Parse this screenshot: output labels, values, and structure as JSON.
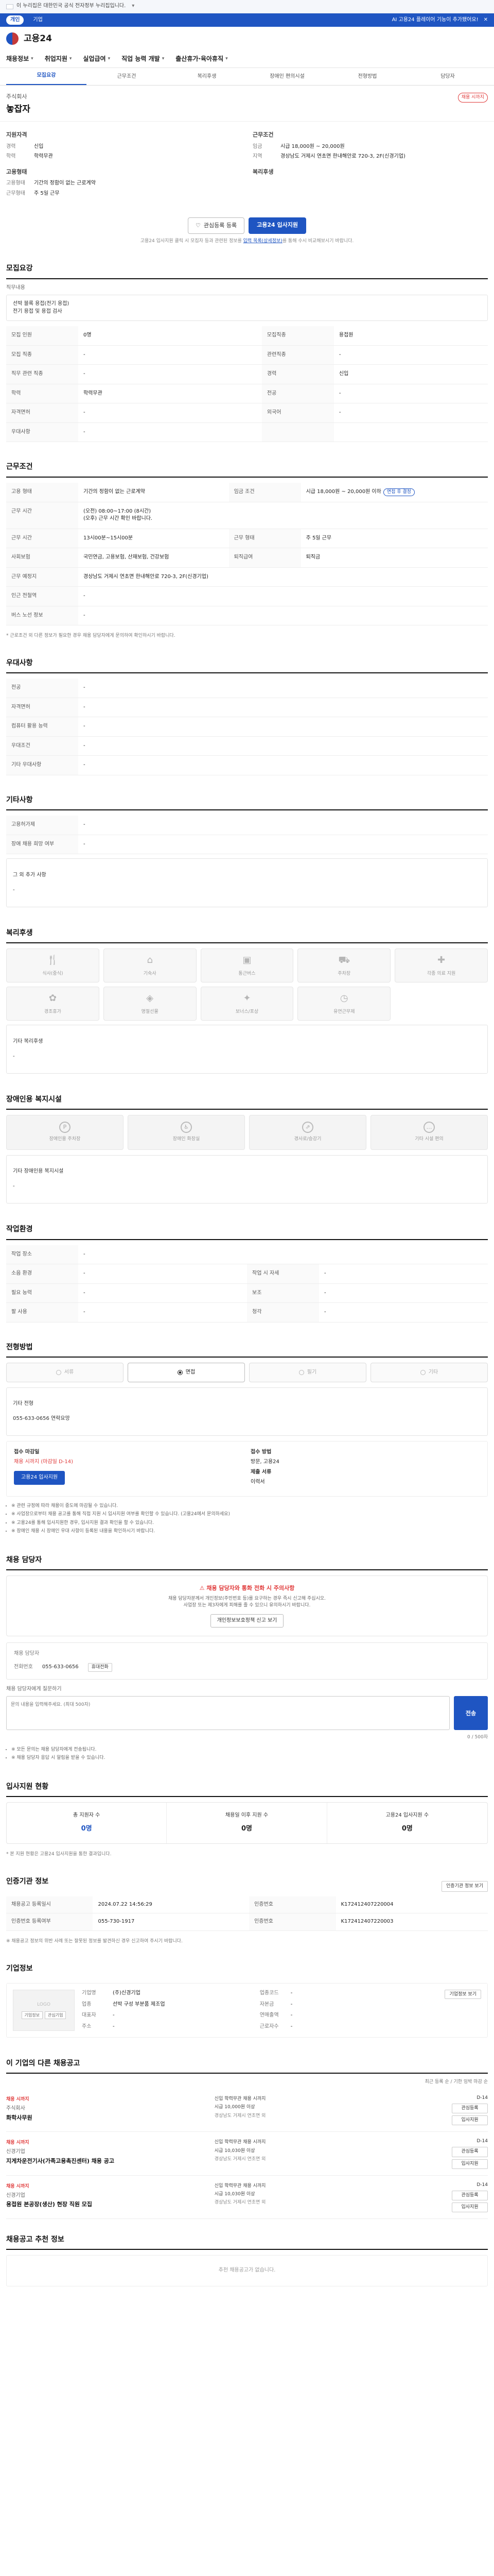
{
  "gov_notice": {
    "text": "이 누리집은 대한민국 공식 전자정부 누리집입니다."
  },
  "util_bar": {
    "segments": [
      "개인",
      "기업"
    ],
    "right_notice": "AI 고용24 플레이어 기능이 추가됐어요!"
  },
  "header": {
    "logo_text": "고용24"
  },
  "gnb": {
    "items": [
      "채용정보",
      "취업지원",
      "실업급여",
      "직업 능력 개발",
      "출산휴가·육아휴직"
    ]
  },
  "subtabs": [
    "모집요강",
    "근무조건",
    "복리후생",
    "장애인 편의시설",
    "전형방법",
    "담당자"
  ],
  "company": {
    "name": "주식회사",
    "title": "놓잡자",
    "badge": "채용 시까지"
  },
  "summary": {
    "left_title": "지원자격",
    "left_rows": [
      {
        "k": "경력",
        "v": "신입"
      },
      {
        "k": "학력",
        "v": "학력무관"
      }
    ],
    "left_title2": "고용형태",
    "left_rows2": [
      {
        "k": "고용형태",
        "v": "기간의 정함이 없는 근로계약"
      },
      {
        "k": "근무형태",
        "v": "주 5일 근무"
      }
    ],
    "right_title": "근무조건",
    "right_rows": [
      {
        "k": "임금",
        "v": "시급 18,000원 ~ 20,000원"
      },
      {
        "k": "지역",
        "v": "경상남도 거제시 연초면 한내해안로 720-3, 2F(신경기업)"
      }
    ],
    "right_title2": "복리후생",
    "right_rows2": []
  },
  "cta": {
    "interest": "관심등록 등록",
    "apply": "고용24 입사지원",
    "note_prefix": "고용24 입사지원 클릭 시 모집자 등과 관련된 정보를 ",
    "note_link": "입력 목록(상세정보)",
    "note_suffix": "를 통해 수시 비교해보시기 바랍니다."
  },
  "recruit": {
    "title": "모집요강",
    "duty_label": "직무내용",
    "duty_text": "선박 블록 용접(전기 용접)\n전기 용접 및 용접 검사",
    "rows": [
      [
        {
          "k": "모집 인원",
          "v": "0명"
        },
        {
          "k": "모집직종",
          "v": "용접원"
        }
      ],
      [
        {
          "k": "모집 직종",
          "v": "-"
        },
        {
          "k": "관련직종",
          "v": "-"
        }
      ],
      [
        {
          "k": "직무 관련 직종",
          "v": "-"
        },
        {
          "k": "경력",
          "v": "신입"
        }
      ],
      [
        {
          "k": "학력",
          "v": "학력무관"
        },
        {
          "k": "전공",
          "v": "-"
        }
      ],
      [
        {
          "k": "자격면허",
          "v": "-"
        },
        {
          "k": "외국어",
          "v": "-"
        }
      ],
      [
        {
          "k": "우대사항",
          "v": "-"
        },
        {
          "k": "",
          "v": ""
        }
      ]
    ],
    "simple_rows": [
      {
        "k": "모집 인원",
        "v": "0명"
      },
      {
        "k": "모집 직종",
        "v": "용접원"
      },
      {
        "k": "관련 직종",
        "v": "-"
      },
      {
        "k": "경력",
        "v": "신입"
      },
      {
        "k": "학력",
        "v": "학력무관"
      }
    ]
  },
  "conditions": {
    "title": "근무조건",
    "rows": [
      {
        "k": "고용 형태",
        "v": "기간의 정함이 없는 근로계약",
        "k2": "임금 조건",
        "v2": "시급 18,000원 ~ 20,000원 이하",
        "tag": "면접 후 결정"
      },
      {
        "k": "근무 시간",
        "v": "(오전) 08:00~17:00 (8시간)\n(오후) 근무 시간 확인 바랍니다.",
        "k2": "",
        "v2": ""
      },
      {
        "k": "근무 시간",
        "v": "13시00분~15시00분",
        "k2": "근무 형태",
        "v2": "주 5일 근무"
      },
      {
        "k": "사회보험",
        "v": "국민연금, 고용보험, 산재보험, 건강보험",
        "k2": "퇴직급여",
        "v2": "퇴직금"
      },
      {
        "k": "근무 예정지",
        "v": "경상남도 거제시 연초면 한내해안로 720-3, 2F(신경기업)",
        "k2": "",
        "v2": ""
      },
      {
        "k": "인근 전철역",
        "v": "-",
        "k2": "",
        "v2": ""
      },
      {
        "k": "버스 노선 정보",
        "v": "-",
        "k2": "",
        "v2": ""
      }
    ],
    "note": "* 근로조건 외 다른 정보가 필요한 경우 채용 담당자에게 문의하여 확인하시기 바랍니다."
  },
  "prefer": {
    "title": "우대사항",
    "rows": [
      {
        "k": "전공",
        "v": "-"
      },
      {
        "k": "자격면허",
        "v": "-"
      },
      {
        "k": "컴퓨터 활용 능력",
        "v": "-"
      },
      {
        "k": "우대조건",
        "v": "-"
      },
      {
        "k": "기타 우대사항",
        "v": "-"
      }
    ]
  },
  "other": {
    "title": "기타사항",
    "rows": [
      {
        "k": "고용허가제",
        "v": "-"
      },
      {
        "k": "장애 채용 희망 여부",
        "v": "-"
      }
    ],
    "box_label": "그 외 추가 사항",
    "box_text": "-"
  },
  "welfare": {
    "title": "복리후생",
    "items": [
      {
        "icon": "meal-icon",
        "label": "식사(중식)"
      },
      {
        "icon": "dorm-icon",
        "label": "기숙사"
      },
      {
        "icon": "commute-icon",
        "label": "통근버스"
      },
      {
        "icon": "car-icon",
        "label": "주차장"
      },
      {
        "icon": "insurance-icon",
        "label": "각종 의료 지원"
      },
      {
        "icon": "leave-icon",
        "label": "경조휴가"
      },
      {
        "icon": "bonus-icon",
        "label": "명절선물"
      },
      {
        "icon": "gift-icon",
        "label": "보너스/포상"
      },
      {
        "icon": "clock-icon",
        "label": "유연근무제"
      }
    ],
    "etc_label": "기타 복리후생",
    "etc_text": "-"
  },
  "disability": {
    "title": "장애인용 복지시설",
    "items": [
      {
        "label": "장애인용 주차장"
      },
      {
        "label": "장애인 화장실"
      },
      {
        "label": "경사로/승강기"
      },
      {
        "label": "기타 시설 편의"
      }
    ],
    "etc_label": "기타 장애인용 복지시설",
    "etc_text": "-"
  },
  "workplace": {
    "title": "작업환경",
    "rows": [
      {
        "k": "작업 장소",
        "v": "-",
        "k2": "",
        "v2": ""
      },
      {
        "k": "소음 환경",
        "v": "-",
        "k2": "작업 시 자세",
        "v2": "-"
      },
      {
        "k": "필요 능력",
        "v": "-",
        "k2": "보조",
        "v2": "-"
      },
      {
        "k": "팔 사용",
        "v": "-",
        "k2": "청각",
        "v2": "-"
      }
    ]
  },
  "selection": {
    "title": "전형방법",
    "methods": [
      {
        "label": "서류",
        "on": false
      },
      {
        "label": "면접",
        "on": true
      },
      {
        "label": "필기",
        "on": false
      },
      {
        "label": "기타",
        "on": false
      }
    ],
    "doc_label": "기타 전형",
    "doc_text": "055-633-0656 연락요망"
  },
  "apply_method": {
    "deadline_label": "접수 마감일",
    "deadline_value": "채용 시까지 (마감일 D-14)",
    "method_label": "접수 방법",
    "method_value": "방문, 고용24",
    "docs_label": "제출 서류",
    "docs_value": "이력서",
    "apply_btn": "고용24 입사지원",
    "bullets": [
      "※ 관련 규정에 따라 채용이 중도에 마감될 수 있습니다.",
      "※ 사업장으로부터 채용 공고를 통해 직접 지원 시 입사지원 여부를 확인할 수 있습니다. (고용24에서 문의하세요)",
      "※ 고용24를 통해 입사지원한 경우, 입사지원 결과 확인을 할 수 있습니다.",
      "※ 장애인 채용 시 장애인 우대 사항이 등록된 내용을 확인하시기 바랍니다."
    ]
  },
  "contact": {
    "title": "채용 담당자",
    "warn_title": "채용 담당자와 통화 전화 시 주의사항",
    "warn_desc": "채용 담당자분께서 개인정보(주민번호 등)를 요구하는 경우 즉시 신고해 주십시오.\n사업장 또는 제3자에게 피해를 줄 수 있으니 유의하시기 바랍니다.",
    "warn_btn": "개인정보보호정책 신고 보기",
    "name_label": "채용 담당자",
    "phone_label": "전화번호",
    "phone_value": "055-633-0656",
    "extra_chip": "휴대전화",
    "msg_label": "채용 담당자에게 질문하기",
    "msg_placeholder": "문의 내용을 입력해주세요. (최대 500자)",
    "msg_count": "0 / 500자",
    "msg_send": "전송",
    "bullets": [
      "※ 모든 문의는 채용 담당자에게 전송됩니다.",
      "※ 채용 담당자 응답 시 알림을 받을 수 있습니다."
    ]
  },
  "stats": {
    "title": "입사지원 현황",
    "cells": [
      {
        "t": "총 지원자 수",
        "n": "0명"
      },
      {
        "t": "채용일 이후 지원 수",
        "n": "0명"
      },
      {
        "t": "고용24 입사지원 수",
        "n": "0명"
      }
    ],
    "note": "* 본 지원 현황은 고용24 입사지원을 통한 결과입니다."
  },
  "notice_info": {
    "title": "인증기관 정보",
    "link": "인증기관 정보 보기",
    "rows": [
      {
        "k": "채용공고 등록일시",
        "v": "2024.07.22 14:56:29",
        "k2": "인증번호",
        "v2": "K172412407220004"
      },
      {
        "k": "인증번호 등록여부",
        "v": "055-730-1917",
        "k2": "인증번호",
        "v2": "K172412407220003"
      }
    ],
    "note": "※ 채용공고 정보의 위반 사례 또는 잘못된 정보를 발견하신 경우 신고하여 주시기 바랍니다."
  },
  "company_info": {
    "title": "기업정보",
    "btn": "기업정보 보기",
    "logo_text": "LOGO",
    "mini": [
      "기업정보",
      "관심기업"
    ],
    "rows": [
      {
        "k": "기업명",
        "v": "(주)신경기업",
        "k2": "업종코드",
        "v2": "-"
      },
      {
        "k": "업종",
        "v": "선박 구성 부분품 제조업",
        "k2": "자본금",
        "v2": "-"
      },
      {
        "k": "대표자",
        "v": "-",
        "k2": "연매출액",
        "v2": "-"
      },
      {
        "k": "주소",
        "v": "-",
        "k2": "근로자수",
        "v2": "-"
      }
    ]
  },
  "other_jobs": {
    "title": "이 기업의 다른 채용공고",
    "sort": "최근 등록 순 / 기한 임박 마감 순",
    "items": [
      {
        "badge": "채용 시까지",
        "co": "주식회사",
        "ttl": "화학사무원",
        "meta1": "신입  학력무관  채용 시까지",
        "meta2": "시급 10,000원 이상",
        "meta3": "경상남도 거제시 연초면 외",
        "dd": "D-14",
        "b1": "관심등록",
        "b2": "입사지원"
      },
      {
        "badge": "채용 시까지",
        "co": "신경기업",
        "ttl": "지게차운전기사(가족고용촉진센터) 채용 공고",
        "meta1": "신입  학력무관  채용 시까지",
        "meta2": "시급 10,030원 이상",
        "meta3": "경상남도 거제시 연초면 외",
        "dd": "D-14",
        "b1": "관심등록",
        "b2": "입사지원"
      },
      {
        "badge": "채용 시까지",
        "co": "신경기업",
        "ttl": "용접원 본공장(생산) 현장 직원 모집",
        "meta1": "신입  학력무관  채용 시까지",
        "meta2": "시급 10,030원 이상",
        "meta3": "경상남도 거제시 연초면 외",
        "dd": "D-14",
        "b1": "관심등록",
        "b2": "입사지원"
      }
    ]
  },
  "recommended": {
    "title": "채용공고 추천 정보",
    "empty": "추천 채용공고가 없습니다."
  }
}
